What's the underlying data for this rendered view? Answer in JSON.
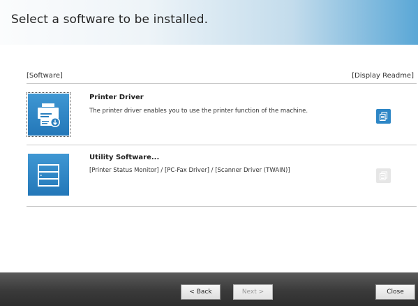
{
  "header": {
    "title": "Select a software to be installed."
  },
  "columns": {
    "software": "[Software]",
    "readme": "[Display Readme]"
  },
  "items": [
    {
      "title": "Printer Driver",
      "description": "The printer driver enables you to use the printer function of the machine.",
      "icon": "printer-download-icon",
      "selected": true,
      "readme_enabled": true
    },
    {
      "title": "Utility Software...",
      "description": "[Printer Status Monitor] / [PC-Fax Driver] / [Scanner Driver (TWAIN)]",
      "icon": "utility-stack-icon",
      "selected": false,
      "readme_enabled": false
    }
  ],
  "footer": {
    "back": "< Back",
    "next": "Next >",
    "close": "Close"
  },
  "colors": {
    "accent": "#2d86c6",
    "header_gradient_end": "#5aa7d6",
    "footer_bg": "#3a3a3a"
  }
}
